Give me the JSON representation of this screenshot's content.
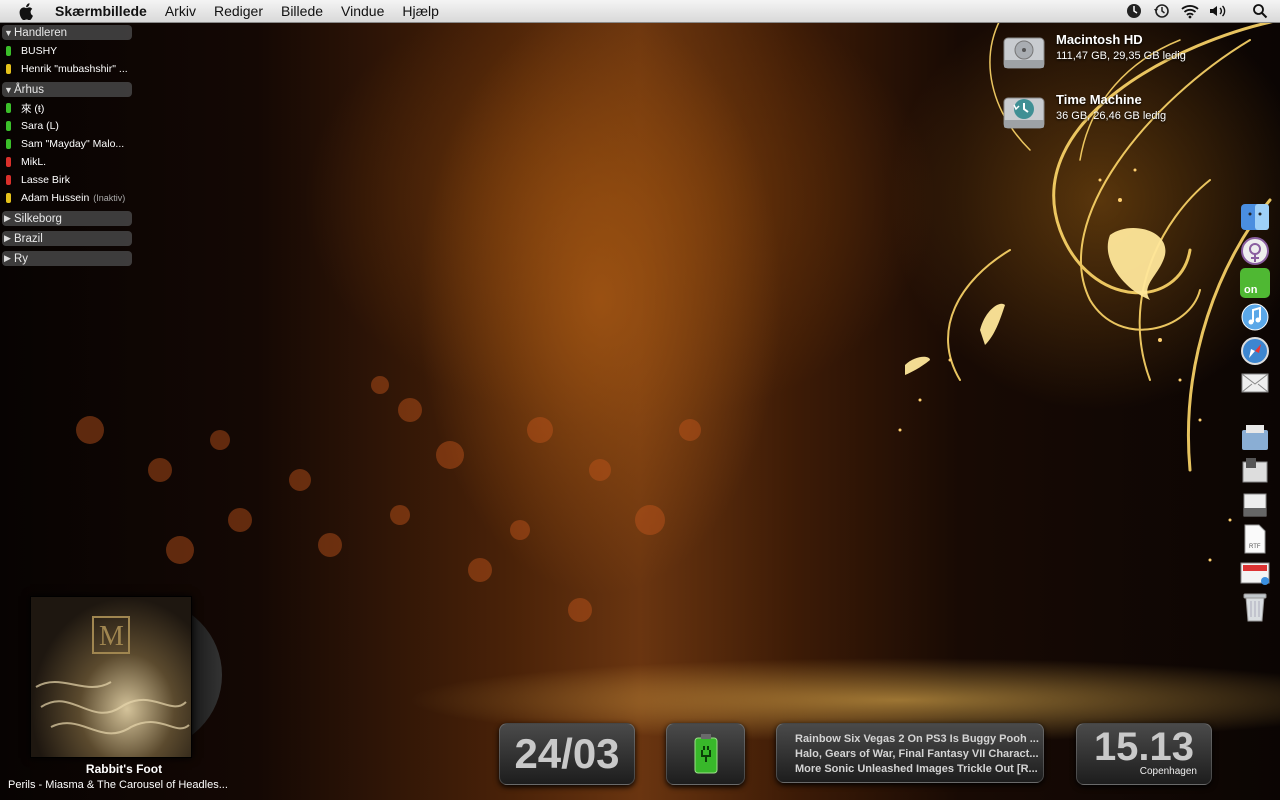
{
  "menubar": {
    "app_name": "Skærmbillede",
    "menus": [
      "Arkiv",
      "Rediger",
      "Billede",
      "Vindue",
      "Hjælp"
    ],
    "status_icons": [
      "time-machine-clock-icon",
      "time-machine-icon",
      "wifi-icon",
      "volume-icon",
      "spotlight-icon"
    ]
  },
  "buddy_list": {
    "groups": [
      {
        "name": "Handleren",
        "expanded": true,
        "buddies": [
          {
            "name": "BUSHY",
            "status": "available",
            "note": ""
          },
          {
            "name": "Henrik \"mubashshir\" ...",
            "status": "idle",
            "note": ""
          }
        ]
      },
      {
        "name": "Århus",
        "expanded": true,
        "buddies": [
          {
            "name": "來 (ŧ)",
            "status": "available",
            "note": ""
          },
          {
            "name": "Sara (L)",
            "status": "available",
            "note": ""
          },
          {
            "name": "Sam \"Mayday\" Malo...",
            "status": "available",
            "note": ""
          },
          {
            "name": "MikL.",
            "status": "busy",
            "note": ""
          },
          {
            "name": "Lasse Birk",
            "status": "busy",
            "note": ""
          },
          {
            "name": "Adam Hussein",
            "status": "idle",
            "note": "(Inaktiv)"
          }
        ]
      },
      {
        "name": "Silkeborg",
        "expanded": false,
        "buddies": []
      },
      {
        "name": "Brazil",
        "expanded": false,
        "buddies": []
      },
      {
        "name": "Ry",
        "expanded": false,
        "buddies": []
      }
    ],
    "status_colors": {
      "available": "#3bbf2a",
      "idle": "#e5c21b",
      "busy": "#d9302b"
    }
  },
  "drives": [
    {
      "name": "Macintosh HD",
      "info": "111,47 GB, 29,35 GB ledig",
      "icon": "hard-drive-icon"
    },
    {
      "name": "Time Machine",
      "info": "36 GB, 26,46 GB ledig",
      "icon": "time-machine-drive-icon"
    }
  ],
  "dock": [
    "finder-icon",
    "adium-icon",
    "on-app-icon",
    "itunes-icon",
    "safari-icon",
    "mail-icon",
    "documents-stack-icon",
    "downloads-stack-icon",
    "applications-stack-icon",
    "rtf-document-icon",
    "preview-icon",
    "trash-icon"
  ],
  "now_playing": {
    "song": "Rabbit's Foot",
    "artist_album": "Perils - Miasma & The Carousel of Headles..."
  },
  "widgets": {
    "date": "24/03",
    "news": [
      "Rainbow Six Vegas 2 On PS3 Is Buggy Pooh ...",
      "Halo, Gears of War, Final Fantasy VII Charact...",
      "More Sonic Unleashed Images Trickle Out [R..."
    ],
    "time": "15.13",
    "city": "Copenhagen"
  }
}
